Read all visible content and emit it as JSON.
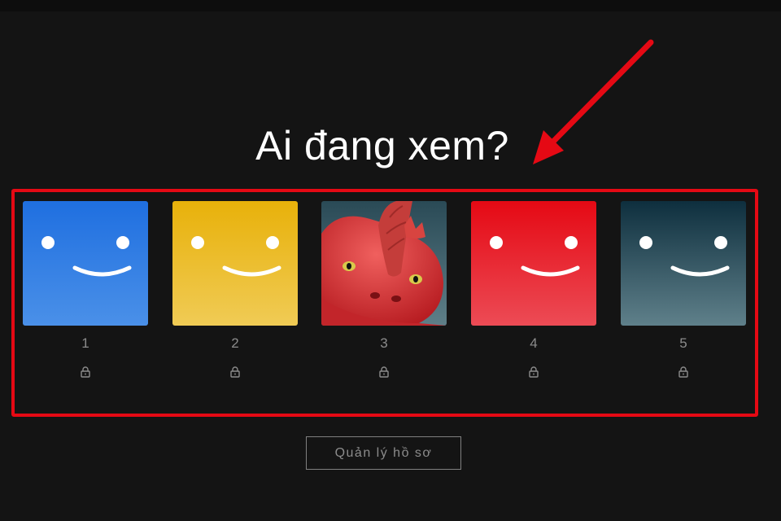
{
  "page": {
    "title": "Ai đang xem?"
  },
  "profiles": [
    {
      "name": "1",
      "avatar": "smiley-blue",
      "locked": true,
      "color_top": "#1f6fe0",
      "color_bottom": "#4a90e8"
    },
    {
      "name": "2",
      "avatar": "smiley-yellow",
      "locked": true,
      "color_top": "#e8b10a",
      "color_bottom": "#f0cb55"
    },
    {
      "name": "3",
      "avatar": "red-dinosaur-character",
      "locked": true
    },
    {
      "name": "4",
      "avatar": "smiley-red",
      "locked": true,
      "color_top": "#e50914",
      "color_bottom": "#ec4b55"
    },
    {
      "name": "5",
      "avatar": "smiley-teal",
      "locked": true,
      "color_top": "#0e2f3e",
      "color_bottom": "#5f808a"
    }
  ],
  "manage_button": {
    "label": "Quản lý hồ sơ"
  },
  "annotation": {
    "highlight_color": "#e50914",
    "arrow_icon": "red-arrow-icon"
  }
}
